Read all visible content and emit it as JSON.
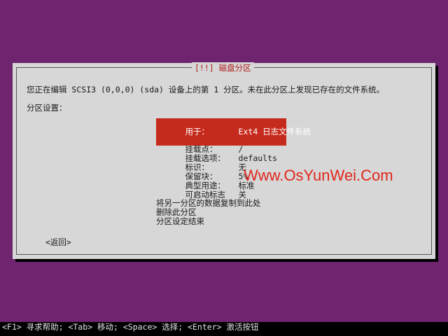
{
  "dialog": {
    "title": "[!!] 磁盘分区",
    "description": "您正在编辑 SCSI3 (0,0,0) (sda) 设备上的第 1 分区。未在此分区上发现已存在的文件系统。",
    "settings_label": "分区设置："
  },
  "settings": [
    {
      "key": "用于：",
      "value": "Ext4 日志文件系统"
    },
    {
      "key": "挂载点：",
      "value": "/"
    },
    {
      "key": "挂载选项：",
      "value": "defaults"
    },
    {
      "key": "标识：",
      "value": "无"
    },
    {
      "key": "保留块：",
      "value": "5%"
    },
    {
      "key": "典型用途：",
      "value": "标准"
    },
    {
      "key": "可启动标志",
      "value": "关"
    }
  ],
  "actions": [
    "将另一分区的数据复制到此处",
    "删除此分区",
    "分区设定结束"
  ],
  "back_label": "<返回>",
  "watermark": "Www.OsYunWei.Com",
  "bottom_bar": "<F1> 寻求帮助; <Tab> 移动; <Space> 选择; <Enter> 激活按钮"
}
